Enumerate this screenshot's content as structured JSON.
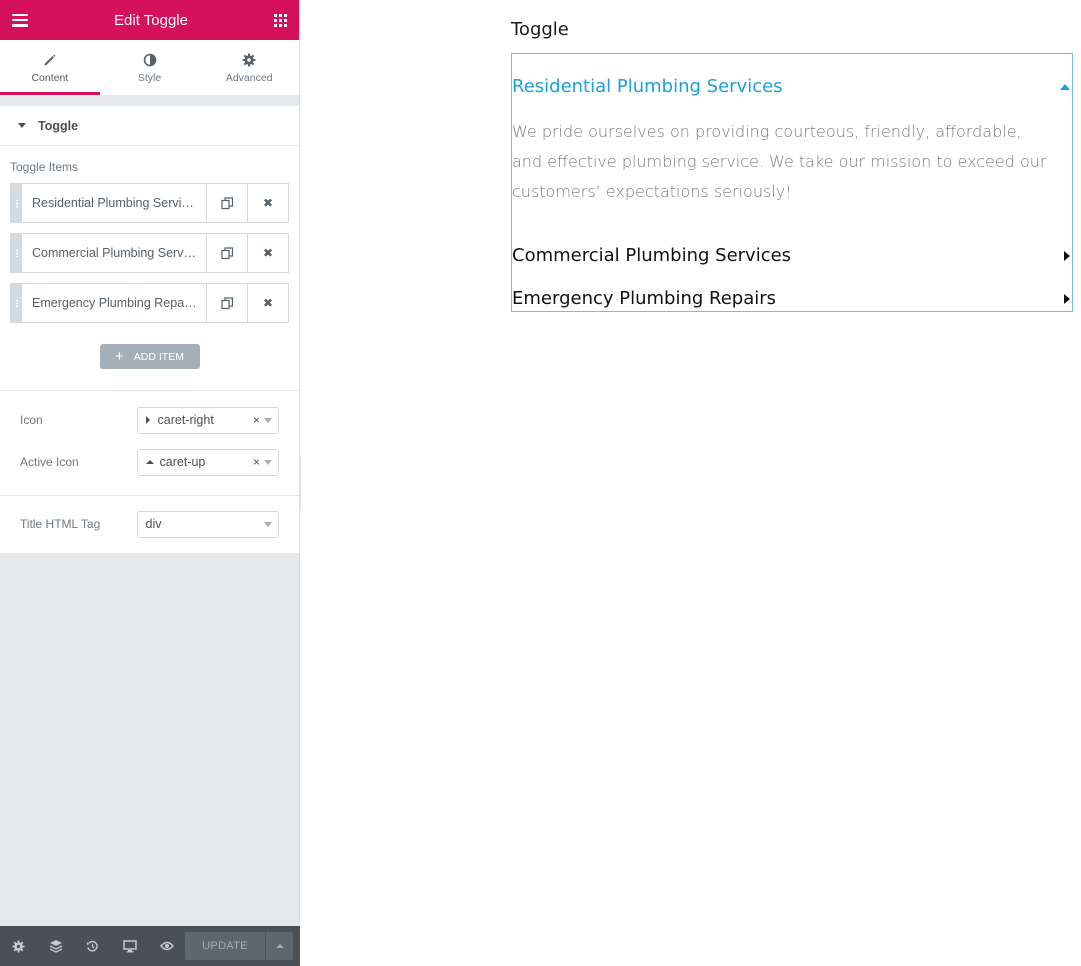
{
  "header": {
    "title": "Edit Toggle"
  },
  "tabs": [
    {
      "label": "Content",
      "icon": "pencil-icon"
    },
    {
      "label": "Style",
      "icon": "half-circle-icon"
    },
    {
      "label": "Advanced",
      "icon": "gear-icon"
    }
  ],
  "section": {
    "title": "Toggle"
  },
  "repeater": {
    "label": "Toggle Items",
    "items": [
      {
        "title": "Residential Plumbing Services"
      },
      {
        "title": "Commercial Plumbing Services"
      },
      {
        "title": "Emergency Plumbing Repairs"
      }
    ],
    "add_label": "ADD ITEM"
  },
  "controls": {
    "icon": {
      "label": "Icon",
      "value": "caret-right",
      "clear": "×"
    },
    "active_icon": {
      "label": "Active Icon",
      "value": "caret-up",
      "clear": "×"
    },
    "title_tag": {
      "label": "Title HTML Tag",
      "value": "div"
    }
  },
  "footer": {
    "update_label": "UPDATE"
  },
  "preview": {
    "heading": "Toggle",
    "toggles": [
      {
        "title": "Residential Plumbing Services",
        "content": "We pride ourselves on providing courteous, friendly, affordable, and effective plumbing service. We take our mission to exceed our customers’ expectations seriously!",
        "active": true
      },
      {
        "title": "Commercial Plumbing Services",
        "active": false
      },
      {
        "title": "Emergency Plumbing Repairs",
        "active": false
      }
    ]
  },
  "colors": {
    "brand": "#d5115c",
    "active_title": "#1ba1d6",
    "widget_outline": "#6ec1e4"
  }
}
